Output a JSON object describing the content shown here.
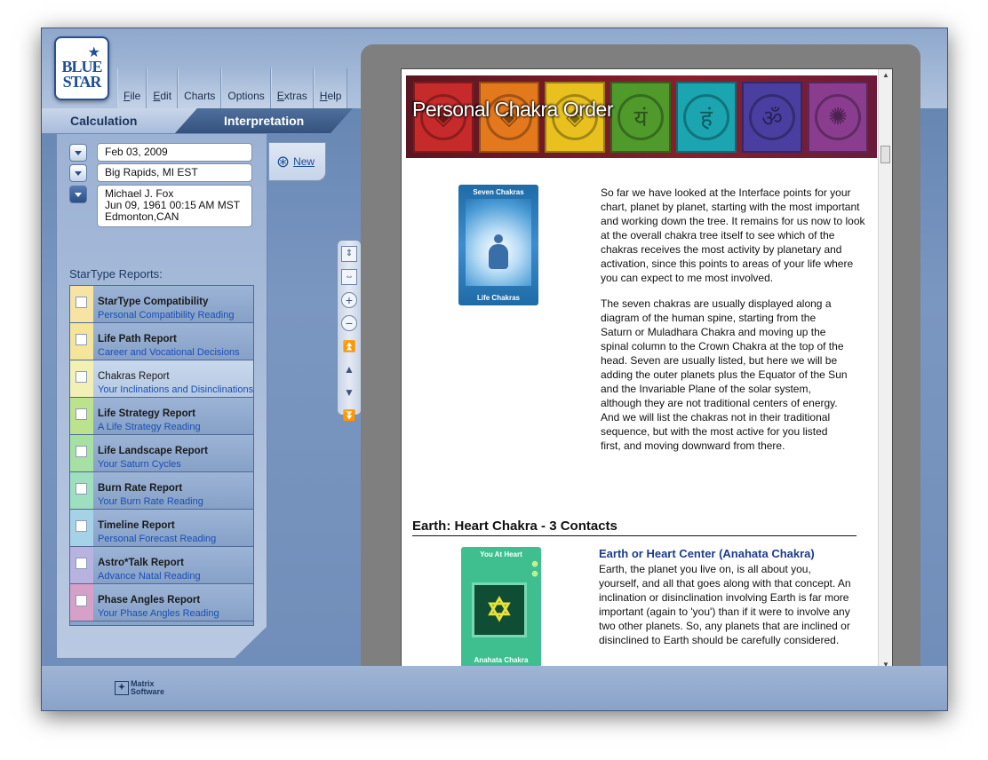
{
  "app": {
    "logo_line1": "BLUE",
    "logo_line2": "STAR",
    "logo_star": "★",
    "menu": [
      "File",
      "Edit",
      "Charts",
      "Options",
      "Extras",
      "Help"
    ],
    "menu_underline": [
      "F",
      "E",
      "",
      "",
      "E",
      "H"
    ],
    "tabs": {
      "calculation": "Calculation",
      "interpretation": "Interpretation"
    }
  },
  "left_panel": {
    "date1": "Feb 03, 2009",
    "location1": "Big Rapids, MI EST",
    "person": [
      "Michael J. Fox",
      "Jun 09, 1961  00:15 AM MST",
      "Edmonton,CAN"
    ],
    "new_button_label": "New",
    "reports_label": "StarType Reports:",
    "reports": [
      {
        "title": "StarType Compatibility",
        "subtitle": "Personal Compatibility Reading",
        "color": "#f7e3a3"
      },
      {
        "title": "Life Path Report",
        "subtitle": "Career and Vocational Decisions",
        "color": "#f4e59a"
      },
      {
        "title": "Chakras Report",
        "subtitle": "Your Inclinations and Disinclinations",
        "color": "#f2f0b4"
      },
      {
        "title": "Life Strategy Report",
        "subtitle": "A Life Strategy Reading",
        "color": "#bde28e"
      },
      {
        "title": "Life Landscape Report",
        "subtitle": "Your Saturn Cycles",
        "color": "#a6e1a3"
      },
      {
        "title": "Burn Rate Report",
        "subtitle": "Your Burn Rate Reading",
        "color": "#9edfbf"
      },
      {
        "title": "Timeline Report",
        "subtitle": "Personal Forecast Reading",
        "color": "#a6d2e8"
      },
      {
        "title": "Astro*Talk Report",
        "subtitle": "Advance Natal Reading",
        "color": "#b8b2e0"
      },
      {
        "title": "Phase Angles Report",
        "subtitle": "Your Phase Angles Reading",
        "color": "#d6a0c8"
      }
    ],
    "active_report_index": 2
  },
  "nav_controls": [
    "⇕",
    "⇔",
    "+",
    "−",
    "⏫",
    "▲",
    "▼",
    "⏬"
  ],
  "document": {
    "banner_title": "Personal Chakra Order",
    "chakra_tiles": [
      {
        "color": "#c62a2a",
        "glyph": "◈"
      },
      {
        "color": "#e4781d",
        "glyph": "◈"
      },
      {
        "color": "#e8c11f",
        "glyph": "◈"
      },
      {
        "color": "#4f9a2b",
        "glyph": "यं"
      },
      {
        "color": "#1aa5b0",
        "glyph": "हं"
      },
      {
        "color": "#4a3fa0",
        "glyph": "ॐ"
      },
      {
        "color": "#8a3d8e",
        "glyph": "✺"
      }
    ],
    "card1_top": "Seven Chakras",
    "card1_bottom": "Life Chakras",
    "para1": "So far we have looked at the Interface points for your chart, planet by planet, starting with the most important and working down the tree. It remains for us now to look at the overall chakra tree itself to see which of the chakras receives the most activity by planetary and activation, since this points to areas of your life where you can expect to me most involved.",
    "para2": "The seven chakras are usually displayed along a diagram of the human spine, starting from the Saturn or Muladhara Chakra and moving up the spinal column to the Crown Chakra at the top of the head. Seven are usually listed, but here we will be adding the outer planets plus the Equator of the Sun and the Invariable Plane of the solar system, although they are not traditional centers of energy. And we will list the chakras not in their traditional sequence, but with the most active for you listed first, and moving downward from there.",
    "section_heading": "Earth: Heart Chakra - 3 Contacts",
    "sub_heading": "Earth or Heart Center (Anahata Chakra)",
    "card2_top": "You At Heart",
    "card2_bottom": "Anahata Chakra",
    "card2_glyph": "✡",
    "para3": "Earth, the planet you live on, is all about you, yourself, and all that goes along with that concept. An inclination or disinclination involving Earth is far more important (again to 'you') than if it were to involve any two other planets. So, any planets that are inclined or disinclined to Earth should be carefully considered."
  },
  "footer": {
    "brand_line1": "Matrix",
    "brand_line2": "Software"
  }
}
